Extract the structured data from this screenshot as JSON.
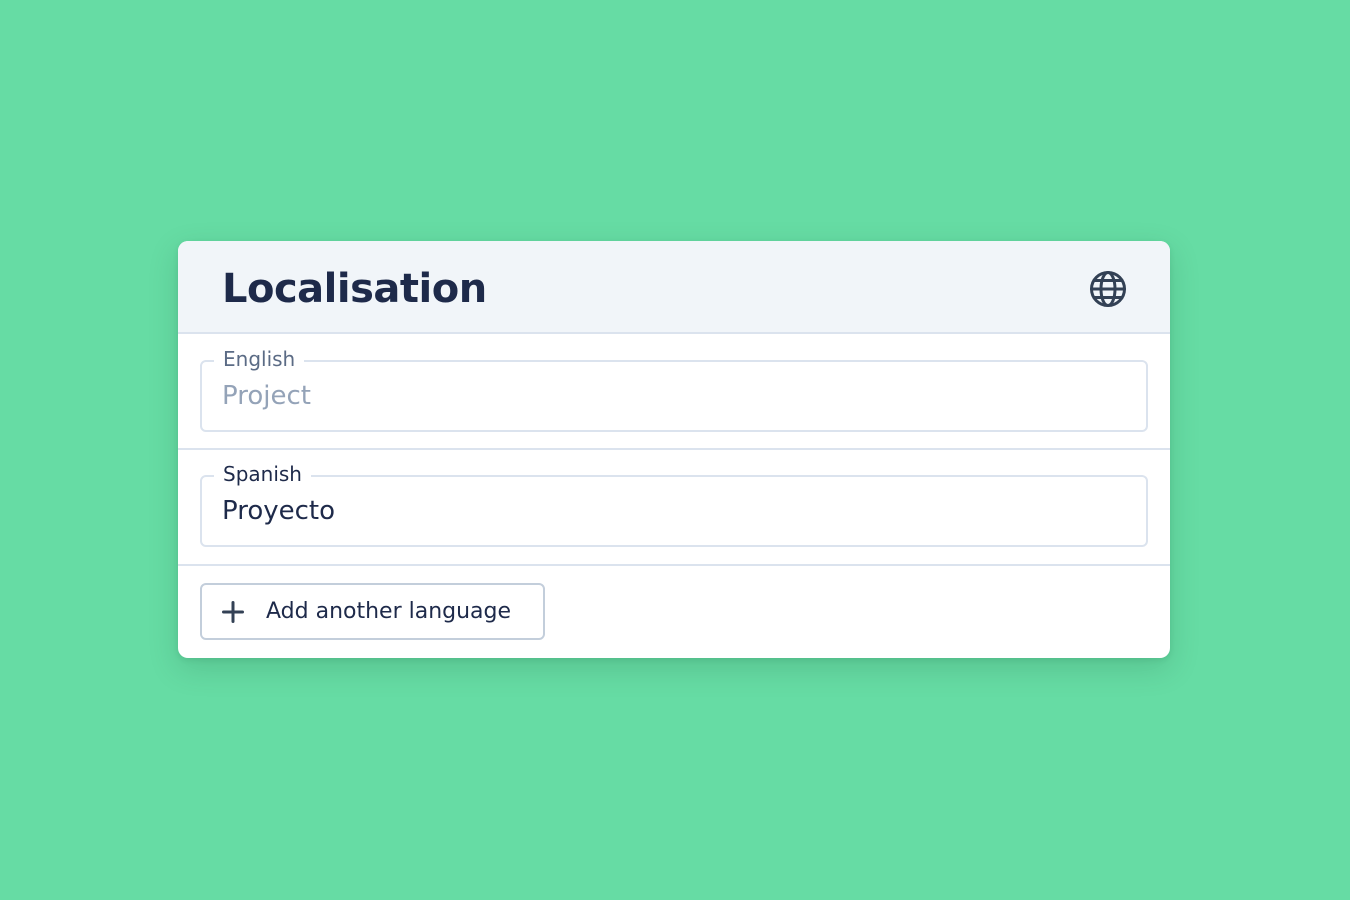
{
  "colors": {
    "background": "#66dca4",
    "card": "#ffffff",
    "header": "#f1f5f9",
    "title": "#1e2a4a",
    "label": "#5b6b85",
    "label_active": "#1e2a4a",
    "placeholder": "#94a3b8",
    "text": "#1e2a4a",
    "border": "#dbe3ee",
    "icon": "#334155"
  },
  "panel": {
    "title": "Localisation",
    "icon": "globe-icon"
  },
  "fields": [
    {
      "language": "English",
      "value": "",
      "placeholder": "Project"
    },
    {
      "language": "Spanish",
      "value": "Proyecto",
      "placeholder": ""
    }
  ],
  "actions": {
    "add_language_label": "Add another language",
    "add_icon": "plus-icon"
  }
}
